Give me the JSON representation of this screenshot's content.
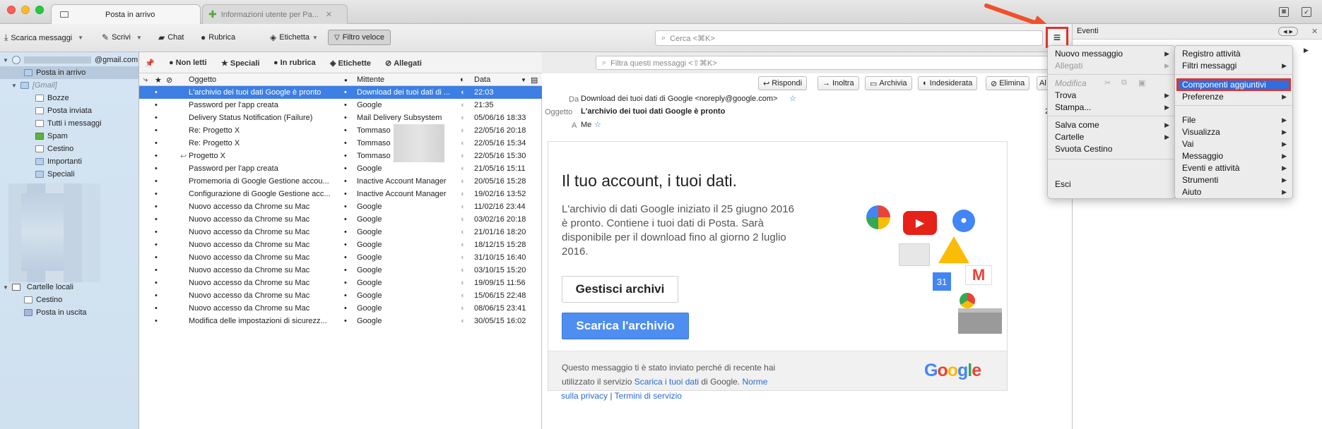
{
  "tabs": [
    {
      "label": "Posta in arrivo"
    },
    {
      "label": "Informazioni utente per Pa..."
    }
  ],
  "toolbar": {
    "get_mail": "Scarica messaggi",
    "write": "Scrivi",
    "chat": "Chat",
    "addressbook": "Rubrica",
    "tag": "Etichetta",
    "quick_filter": "Filtro veloce",
    "search_placeholder": "Cerca <⌘K>"
  },
  "account": {
    "email": "@gmail.com"
  },
  "folders": [
    {
      "label": "Posta in arrivo"
    },
    {
      "label": "[Gmail]"
    },
    {
      "label": "Bozze"
    },
    {
      "label": "Posta inviata"
    },
    {
      "label": "Tutti i messaggi"
    },
    {
      "label": "Spam"
    },
    {
      "label": "Cestino"
    },
    {
      "label": "Importanti"
    },
    {
      "label": "Speciali"
    }
  ],
  "local_folders": {
    "title": "Cartelle locali",
    "items": [
      {
        "label": "Cestino"
      },
      {
        "label": "Posta in uscita"
      }
    ]
  },
  "quick_filter_bar": {
    "unread": "Non letti",
    "starred": "Speciali",
    "contacts": "In rubrica",
    "tags": "Etichette",
    "attachments": "Allegati",
    "filter_placeholder": "Filtra questi messaggi <⇧⌘K>"
  },
  "columns": {
    "subject": "Oggetto",
    "sender": "Mittente",
    "date": "Data"
  },
  "messages": [
    {
      "subject": "L'archivio dei tuoi dati Google è pronto",
      "sender": "Download dei tuoi dati di ...",
      "date": "22:03"
    },
    {
      "subject": "Password per l'app creata",
      "sender": "Google",
      "date": "21:35"
    },
    {
      "subject": "Delivery Status Notification (Failure)",
      "sender": "Mail Delivery Subsystem",
      "date": "05/06/16 18:33"
    },
    {
      "subject": "Re: Progetto X",
      "sender": "Tommaso",
      "date": "22/05/16 20:18"
    },
    {
      "subject": "Re: Progetto X",
      "sender": "Tommaso",
      "date": "22/05/16 15:34"
    },
    {
      "subject": "Progetto X",
      "sender": "Tommaso",
      "date": "22/05/16 15:30"
    },
    {
      "subject": "Password per l'app creata",
      "sender": "Google",
      "date": "21/05/16 15:11"
    },
    {
      "subject": "Promemoria di Google Gestione accou...",
      "sender": "Inactive Account Manager",
      "date": "20/05/16 15:28"
    },
    {
      "subject": "Configurazione di Google Gestione acc...",
      "sender": "Inactive Account Manager",
      "date": "19/02/16 13:52"
    },
    {
      "subject": "Nuovo accesso da Chrome su Mac",
      "sender": "Google",
      "date": "11/02/16 23:44"
    },
    {
      "subject": "Nuovo accesso da Chrome su Mac",
      "sender": "Google",
      "date": "03/02/16 20:18"
    },
    {
      "subject": "Nuovo accesso da Chrome su Mac",
      "sender": "Google",
      "date": "21/01/16 18:20"
    },
    {
      "subject": "Nuovo accesso da Chrome su Mac",
      "sender": "Google",
      "date": "18/12/15 15:28"
    },
    {
      "subject": "Nuovo accesso da Chrome su Mac",
      "sender": "Google",
      "date": "31/10/15 16:40"
    },
    {
      "subject": "Nuovo accesso da Chrome su Mac",
      "sender": "Google",
      "date": "03/10/15 15:20"
    },
    {
      "subject": "Nuovo accesso da Chrome su Mac",
      "sender": "Google",
      "date": "19/09/15 11:56"
    },
    {
      "subject": "Nuovo accesso da Chrome su Mac",
      "sender": "Google",
      "date": "15/06/15 22:48"
    },
    {
      "subject": "Nuovo accesso da Chrome su Mac",
      "sender": "Google",
      "date": "08/06/15 23:41"
    },
    {
      "subject": "Modifica delle impostazioni di sicurezz...",
      "sender": "Google",
      "date": "30/05/15 16:02"
    }
  ],
  "message_actions": {
    "reply": "Rispondi",
    "forward": "Inoltra",
    "archive": "Archivia",
    "junk": "Indesiderata",
    "delete": "Elimina",
    "more": "Al"
  },
  "message_header": {
    "from_label": "Da",
    "from_value": "Download dei tuoi dati di Google <noreply@google.com>",
    "subject_label": "Oggetto",
    "subject_value": "L'archivio dei tuoi dati Google è pronto",
    "to_label": "A",
    "to_value": "Me",
    "time_partial": "2"
  },
  "email_body": {
    "heading": "Il tuo account, i tuoi dati.",
    "paragraph_1": "L'archivio di dati Google iniziato il 25 giugno 2016",
    "paragraph_2": "è pronto. Contiene i tuoi dati di Posta. Sarà",
    "paragraph_3": "disponibile per il download fino al giorno 2 luglio",
    "paragraph_4": "2016.",
    "manage_button": "Gestisci archivi",
    "download_button": "Scarica l'archivio",
    "footer_1": "Questo messaggio ti è stato inviato perché di recente hai",
    "footer_2a": "utilizzato il servizio ",
    "footer_link_1": "Scarica i tuoi dati",
    "footer_2b": " di Google. ",
    "footer_link_2a": "Norme",
    "footer_link_2b": "sulla privacy",
    "footer_sep": " | ",
    "footer_link_3": "Termini di servizio",
    "google_logo": "Google",
    "calendar_day": "31"
  },
  "events_pane": {
    "title": "Eventi"
  },
  "app_menu_left": {
    "items": [
      {
        "label": "Nuovo messaggio"
      },
      {
        "label": "Allegati"
      },
      {
        "label": "Modifica"
      },
      {
        "label": "Trova"
      },
      {
        "label": "Stampa..."
      },
      {
        "label": "Salva come"
      },
      {
        "label": "Cartelle"
      },
      {
        "label": "Svuota Cestino"
      },
      {
        "label": "Esci"
      }
    ]
  },
  "app_menu_right": {
    "items": [
      {
        "label": "Registro attività"
      },
      {
        "label": "Filtri messaggi"
      },
      {
        "label": "Componenti aggiuntivi"
      },
      {
        "label": "Preferenze"
      },
      {
        "label": "File"
      },
      {
        "label": "Visualizza"
      },
      {
        "label": "Vai"
      },
      {
        "label": "Messaggio"
      },
      {
        "label": "Eventi e attività"
      },
      {
        "label": "Strumenti"
      },
      {
        "label": "Aiuto"
      }
    ]
  },
  "colors": {
    "selection": "#3d7fe3",
    "highlight_border": "#e0322b",
    "link": "#2a6bd0",
    "arrow": "#f0502a"
  }
}
